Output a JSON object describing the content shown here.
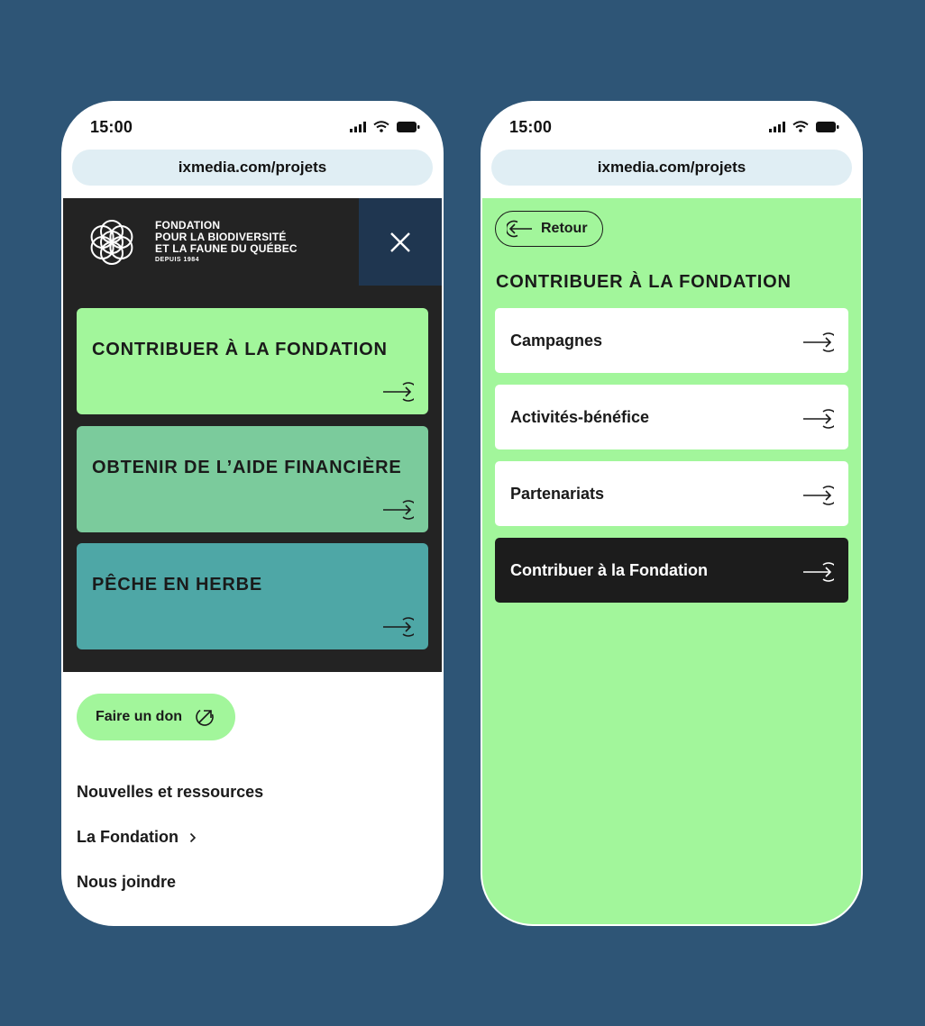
{
  "status_bar": {
    "time": "15:00"
  },
  "browser": {
    "url": "ixmedia.com/projets"
  },
  "left_screen": {
    "logo": {
      "line1": "FONDATION",
      "line2": "POUR LA BIODIVERSITÉ",
      "line3": "ET LA FAUNE DU QUÉBEC",
      "line4": "DEPUIS 1984"
    },
    "cards": [
      {
        "label": "CONTRIBUER À LA FONDATION",
        "color": "#a2f69b"
      },
      {
        "label": "OBTENIR DE L’AIDE FINANCIÈRE",
        "color": "#7bcb9c"
      },
      {
        "label": "PÊCHE EN HERBE",
        "color": "#4ea7a6"
      }
    ],
    "donate_label": "Faire un don",
    "links": [
      {
        "label": "Nouvelles et ressources"
      },
      {
        "label": "La Fondation"
      },
      {
        "label": "Nous joindre"
      }
    ]
  },
  "right_screen": {
    "back_label": "Retour",
    "section_title": "CONTRIBUER À LA FONDATION",
    "items": [
      {
        "label": "Campagnes"
      },
      {
        "label": "Activités-bénéfice"
      },
      {
        "label": "Partenariats"
      },
      {
        "label": "Contribuer à la Fondation"
      }
    ]
  },
  "colors": {
    "background": "#2e5576",
    "accent_green": "#a2f69b",
    "dark": "#232323",
    "navy": "#1f3650"
  }
}
